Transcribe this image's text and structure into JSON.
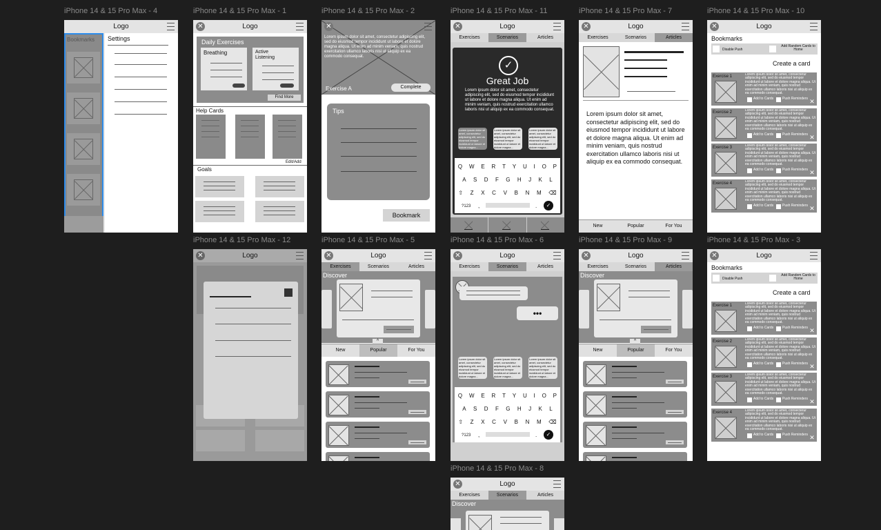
{
  "app": {
    "logo": "Logo"
  },
  "frames": {
    "f4": {
      "label": "iPhone 14 & 15 Pro Max - 4",
      "side_title": "Bookmarks",
      "heading": "Settings"
    },
    "f1": {
      "label": "iPhone 14 & 15 Pro Max - 1",
      "daily": "Daily Exercises",
      "breathing": "Breathing",
      "active": "Active Listening",
      "find_more": "Find More",
      "help_cards": "Help Cards",
      "edit_add": "Edit/Add",
      "goals": "Goals"
    },
    "f2": {
      "label": "iPhone 14 & 15 Pro Max - 2",
      "lorem": "Lorem ipsum dolor sit amet, consectetur adipiscing elit, sed do eiusmod tempor incididunt ut labore et dolore magna aliqua. Ut enim ad minim veniam, quis nostrud exercitation ullamco laboris nisi ut aliquip ex ea commodo consequat.",
      "exercise": "Exercise A",
      "complete": "Complete",
      "tips": "Tips",
      "bookmark": "Bookmark"
    },
    "f11": {
      "label": "iPhone 14 & 15 Pro Max - 11",
      "great": "Great Job",
      "lorem": "Lorem ipsum dolor sit amet, consectetur adipiscing elit, sed do eiusmod tempor incididunt ut labore et dolore magna aliqua. Ut enim ad minim veniam, quis nostrud exercitation ullamco laboris nisi ut aliquip ex ea commodo consequat.",
      "card_text": "Lorem ipsum dolor sit amet, consectetur adipiscing elit, sed do eiusmod tempor incididunt ut labore et dolore magna..."
    },
    "f7": {
      "label": "iPhone 14 & 15 Pro Max - 7",
      "lorem": "Lorem ipsum dolor sit amet, consectetur adipiscing elit, sed do eiusmod tempor incididunt ut labore et dolore magna aliqua. Ut enim ad minim veniam, quis nostrud exercitation ullamco laboris nisi ut aliquip ex ea commodo consequat."
    },
    "f10": {
      "label": "iPhone 14 & 15 Pro Max - 10"
    },
    "f12": {
      "label": "iPhone 14 & 15 Pro Max - 12"
    },
    "f5": {
      "label": "iPhone 14 & 15 Pro Max - 5"
    },
    "f6": {
      "label": "iPhone 14 & 15 Pro Max - 6",
      "dots": "•••"
    },
    "f9": {
      "label": "iPhone 14 & 15 Pro Max - 9"
    },
    "f3": {
      "label": "iPhone 14 & 15 Pro Max - 3"
    },
    "f8": {
      "label": "iPhone 14 & 15 Pro Max - 8"
    }
  },
  "tabs": [
    "Exercises",
    "Scenarios",
    "Articles"
  ],
  "bottom_nav": [
    "New",
    "Popular",
    "For You"
  ],
  "discover": "Discover",
  "keyboard": {
    "row1": [
      "Q",
      "W",
      "E",
      "R",
      "T",
      "Y",
      "U",
      "I",
      "O",
      "P"
    ],
    "row2": [
      "A",
      "S",
      "D",
      "F",
      "G",
      "H",
      "J",
      "K",
      "L"
    ],
    "row3": [
      "⇧",
      "Z",
      "X",
      "C",
      "V",
      "B",
      "N",
      "M",
      "⌫"
    ],
    "num": "?123",
    "comma": ",",
    "period": "."
  },
  "bookmarks": {
    "title": "Bookmarks",
    "disable_push": "Disable Push",
    "add_random": "Add Random Cards to Home",
    "create": "Create a card",
    "exercises": [
      "Exercise 1",
      "Exercise 2",
      "Exercise 3",
      "Exercise 4"
    ],
    "card_text": "Lorem ipsum dolor sit amet, consectetur adipiscing elit, sed do eiusmod tempor incididunt ut labore et dolore magna aliqua. Ut enim ad minim veniam, quis nostrud exercitation ullamco laboris nisi ut aliquip ex ea commodo consequat.",
    "add_to_cards": "Add to Cards",
    "push_reminders": "Push Reminders"
  },
  "colors": {
    "canvas": "#1e1e1e",
    "selection": "#2d8ceb",
    "label": "#8a8a8a"
  }
}
